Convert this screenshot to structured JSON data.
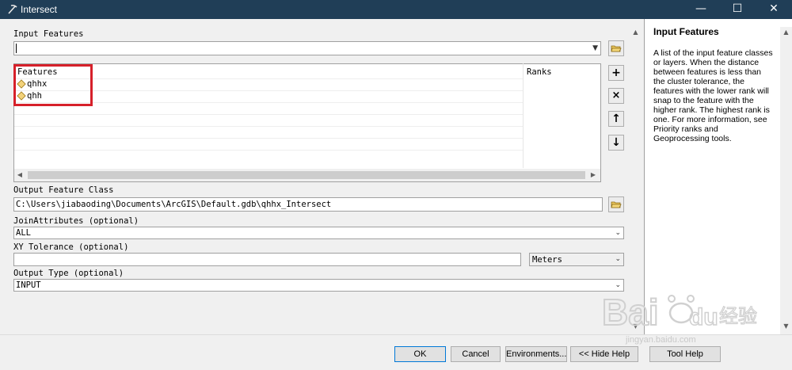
{
  "window": {
    "title": "Intersect",
    "minimize_glyph": "—",
    "maximize_glyph": "☐",
    "close_glyph": "✕"
  },
  "colors": {
    "titlebar": "#203e57",
    "highlight": "#d6202a",
    "panel": "#f0f0f0"
  },
  "form": {
    "input_features_label": "Input Features",
    "features_header": "Features",
    "ranks_header": "Ranks",
    "features": [
      {
        "name": "qhhx"
      },
      {
        "name": "qhh"
      }
    ],
    "output_feature_class_label": "Output Feature Class",
    "output_feature_class_value": "C:\\Users\\jiabaoding\\Documents\\ArcGIS\\Default.gdb\\qhhx_Intersect",
    "join_attributes_label": "JoinAttributes (optional)",
    "join_attributes_value": "ALL",
    "xy_tolerance_label": "XY Tolerance (optional)",
    "xy_tolerance_value": "",
    "xy_tolerance_unit": "Meters",
    "output_type_label": "Output Type (optional)",
    "output_type_value": "INPUT"
  },
  "tool_buttons": {
    "add": "+",
    "remove": "×",
    "up": "↑",
    "down": "↓"
  },
  "help": {
    "title": "Input Features",
    "body": "A list of the input feature classes or layers. When the distance between features is less than the cluster tolerance, the features with the lower rank will snap to the feature with the higher rank. The highest rank is one. For more information, see Priority ranks and Geoprocessing tools."
  },
  "buttons": {
    "ok": "OK",
    "cancel": "Cancel",
    "environments": "Environments...",
    "hide_help": "<< Hide Help",
    "tool_help": "Tool Help"
  },
  "watermark": {
    "logo": "Bai du 经验",
    "url": "jingyan.baidu.com"
  },
  "icons": [
    "pickaxe-icon",
    "folder-icon",
    "feature-class-icon",
    "chevron-down-icon"
  ]
}
